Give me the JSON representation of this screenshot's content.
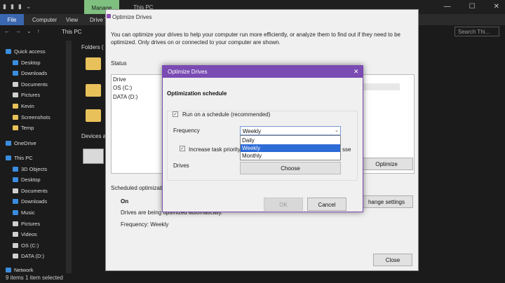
{
  "explorer": {
    "qat": [
      "▮",
      "▮",
      "▮",
      "⌄"
    ],
    "manage_tab": "Manage",
    "window_title": "This PC",
    "window_buttons": [
      "—",
      "☐",
      "✕"
    ],
    "ribbon_tabs": [
      "File",
      "Computer",
      "View",
      "Drive T"
    ],
    "nav_arrows": [
      "←",
      "→",
      "⌄",
      "↑"
    ],
    "address": "This PC",
    "search_placeholder": "Search Thi...",
    "nav_items": [
      {
        "label": "Quick access",
        "color": "#3b8de0"
      },
      {
        "label": "Desktop",
        "color": "#3b8de0"
      },
      {
        "label": "Downloads",
        "color": "#3b8de0"
      },
      {
        "label": "Documents",
        "color": "#cfcfcf"
      },
      {
        "label": "Pictures",
        "color": "#cfcfcf"
      },
      {
        "label": "Kevin",
        "color": "#e8c15a"
      },
      {
        "label": "Screenshots",
        "color": "#e8c15a"
      },
      {
        "label": "Temp",
        "color": "#e8c15a"
      },
      {
        "label": "OneDrive",
        "color": "#3b8de0"
      },
      {
        "label": "This PC",
        "color": "#3b8de0"
      },
      {
        "label": "3D Objects",
        "color": "#3b8de0"
      },
      {
        "label": "Desktop",
        "color": "#3b8de0"
      },
      {
        "label": "Documents",
        "color": "#cfcfcf"
      },
      {
        "label": "Downloads",
        "color": "#3b8de0"
      },
      {
        "label": "Music",
        "color": "#3b8de0"
      },
      {
        "label": "Pictures",
        "color": "#cfcfcf"
      },
      {
        "label": "Videos",
        "color": "#cfcfcf"
      },
      {
        "label": "OS (C:)",
        "color": "#cfcfcf"
      },
      {
        "label": "DATA (D:)",
        "color": "#cfcfcf"
      },
      {
        "label": "Network",
        "color": "#3b8de0"
      }
    ],
    "folders_label": "Folders (",
    "devices_label": "Devices a",
    "status_text": "9 items    1 item selected"
  },
  "optimize": {
    "title": "Optimize Drives",
    "description": "You can optimize your drives to help your computer run more efficiently, or analyze them to find out if they need to be optimized. Only drives on or connected to your computer are shown.",
    "status_label": "Status",
    "drive_header": "Drive",
    "drives": [
      "OS (C:)",
      "DATA (D:)"
    ],
    "optimize_button": "Optimize",
    "scheduled_label": "Scheduled optimizati",
    "on_label": "On",
    "drives_optimized": "Drives are being optimized automatically.",
    "frequency_line": "Frequency: Weekly",
    "change_settings": "hange settings",
    "close_button": "Close"
  },
  "dialog": {
    "title": "Optimize Drives",
    "close_glyph": "✕",
    "schedule_heading": "Optimization schedule",
    "run_label": "Run on a schedule (recommended)",
    "frequency_label": "Frequency",
    "frequency_value": "Weekly",
    "frequency_options": [
      "Daily",
      "Weekly",
      "Monthly"
    ],
    "increase_label": "Increase task priority",
    "increase_tail": "sse",
    "drives_label": "Drives",
    "choose_button": "Choose",
    "ok_button": "OK",
    "cancel_button": "Cancel",
    "check_glyph": "✓"
  },
  "colors": {
    "accent": "#7a4bb3",
    "selection": "#2d6bd6"
  }
}
